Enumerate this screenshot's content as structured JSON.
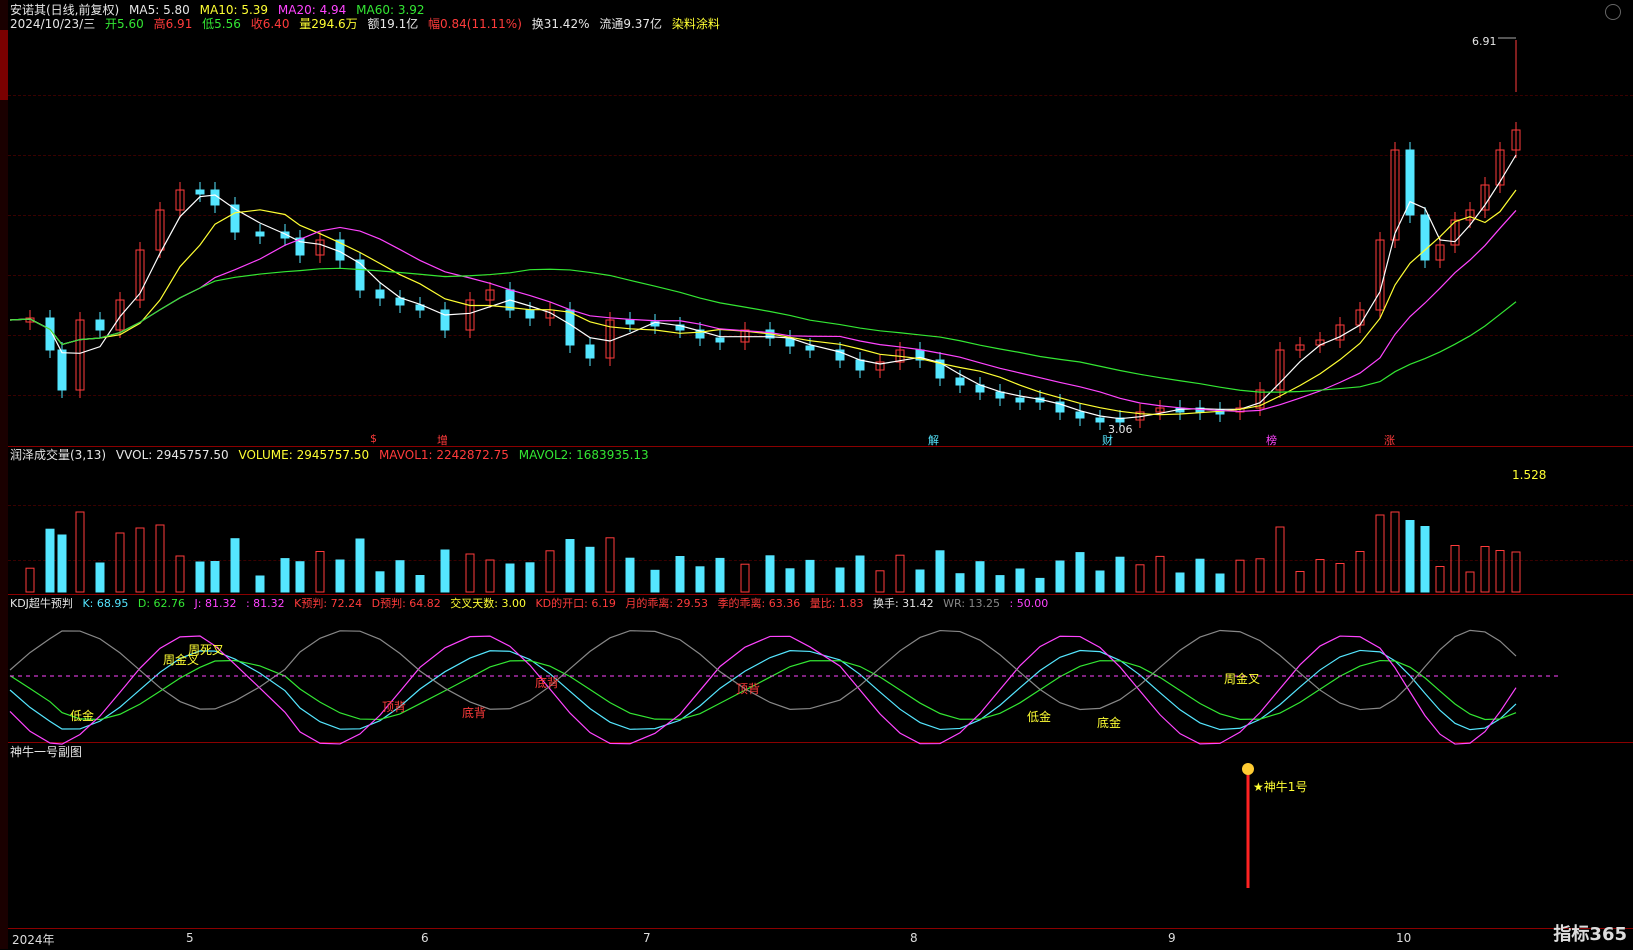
{
  "header_main": {
    "title": "安诺其(日线,前复权)",
    "ma5": "MA5: 5.80",
    "ma10": "MA10: 5.39",
    "ma20": "MA20: 4.94",
    "ma60": "MA60: 3.92",
    "date": "2024/10/23/三",
    "open": "开5.60",
    "high": "高6.91",
    "low": "低5.56",
    "close": "收6.40",
    "volume": "量294.6万",
    "amount": "额19.1亿",
    "change": "幅0.84(11.11%)",
    "turnover": "换31.42%",
    "float": "流通9.37亿",
    "industry": "染料涂料"
  },
  "price_labels": {
    "high_mark": "6.91",
    "low_mark": "3.06"
  },
  "event_labels": [
    "$",
    "增",
    "解",
    "财",
    "榜",
    "涨"
  ],
  "header_vol": {
    "name": "润泽成交量(3,13)",
    "vvol": "VVOL: 2945757.50",
    "volume": "VOLUME: 2945757.50",
    "mavol1": "MAVOL1: 2242872.75",
    "mavol2": "MAVOL2: 1683935.13",
    "scale": "1.528"
  },
  "header_kdj": {
    "name": "KDJ超牛预判",
    "k": "K: 68.95",
    "d": "D: 62.76",
    "j": "J: 81.32",
    "j2": ": 81.32",
    "kpre": "K预判: 72.24",
    "dpre": "D预判: 64.82",
    "cross": "交叉天数: 3.00",
    "kdopen": "KD的开口: 6.19",
    "month_dev": "月的乖离: 29.53",
    "season_dev": "季的乖离: 63.36",
    "vol_ratio": "量比: 1.83",
    "hand": "换手: 31.42",
    "wr": "WR: 13.25",
    "fifty": ": 50.00"
  },
  "kdj_signals": [
    "低金",
    "周金叉",
    "周死叉",
    "顶背",
    "底背",
    "底背",
    "顶背",
    "底背",
    "低金",
    "底金",
    "周金叉"
  ],
  "header_sn": {
    "name": "神牛一号副图",
    "signal": "★神牛1号"
  },
  "time_axis": [
    "2024年",
    "5",
    "6",
    "7",
    "8",
    "9",
    "10"
  ],
  "logo": "指标365",
  "colors": {
    "up": "#ff3b3b",
    "down": "#55e6ff",
    "ma5": "#ffffff",
    "ma10": "#ffff33",
    "ma20": "#ff44ff",
    "ma60": "#33e633"
  }
}
